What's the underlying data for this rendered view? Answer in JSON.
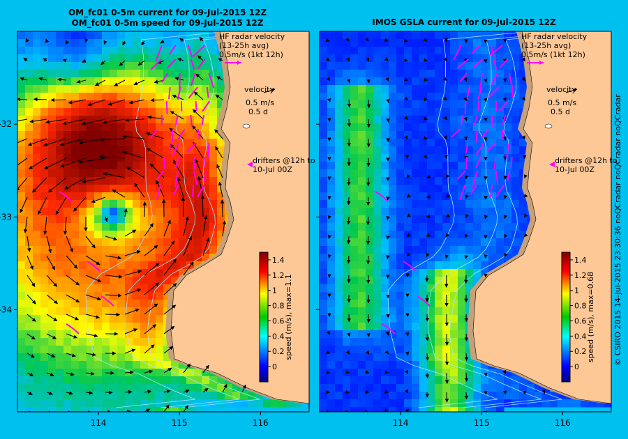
{
  "colors": {
    "background": "#00c0f0",
    "land": "#fdc896",
    "shelf": "#c8a078",
    "radar": "#ff00ff",
    "arrow": "#000000"
  },
  "panels": [
    {
      "title_line1": "OM_fc01 0-5m current for 09-Jul-2015 12Z",
      "title_line2": "OM_fc01 0-5m speed for 09-Jul-2015 12Z",
      "legend_radar": [
        "HF radar velocity",
        "(13-25h avg)",
        "0.5m/s (1kt 12h)"
      ],
      "legend_velocity": [
        "velocity",
        "0.5 m/s",
        "0.5 d"
      ],
      "legend_drifters": [
        "drifters @12h to",
        "10-Jul 00Z"
      ],
      "colorbar_label": "speed (m/s), max=1.1"
    },
    {
      "title_line1": "IMOS GSLA current for 09-Jul-2015 12Z",
      "title_line2": "",
      "legend_radar": [
        "HF radar velocity",
        "(13-25h avg)",
        "0.5m/s (1kt 12h)"
      ],
      "legend_velocity": [
        "velocity",
        "0.5 m/s",
        "0.5 d"
      ],
      "legend_drifters": [
        "drifters @12h to",
        "10-Jul 00Z"
      ],
      "colorbar_label": "speed (m/s), max=0.68"
    }
  ],
  "credit": "© CSIRO 2015  14-Jul-2015 23:30:36 noQCradar noQCradar noQCradar",
  "chart_data": [
    {
      "type": "heatmap",
      "title": "OM_fc01 0-5m current for 09-Jul-2015 12Z",
      "subtitle": "OM_fc01 0-5m speed for 09-Jul-2015 12Z",
      "xlim": [
        113.0,
        116.6
      ],
      "ylim": [
        -35.1,
        -31.0
      ],
      "xticks": [
        114,
        115,
        116
      ],
      "yticks": [
        -32,
        -33,
        -34
      ],
      "colorbar": {
        "label": "speed (m/s), max=1.1",
        "ticks": [
          0,
          0.2,
          0.4,
          0.6,
          0.8,
          1,
          1.2,
          1.4
        ],
        "range": [
          -0.2,
          1.5
        ]
      },
      "max_speed": 1.1,
      "eddies": [
        {
          "lon": 113.85,
          "lat": -31.65,
          "strength": 0.45,
          "sense": "anticlockwise"
        },
        {
          "lon": 114.15,
          "lat": -32.9,
          "strength": 1.1,
          "sense": "clockwise"
        }
      ]
    },
    {
      "type": "heatmap",
      "title": "IMOS GSLA current for 09-Jul-2015 12Z",
      "xlim": [
        113.0,
        116.6
      ],
      "ylim": [
        -35.1,
        -31.0
      ],
      "xticks": [
        114,
        115,
        116
      ],
      "yticks": [
        -32,
        -33,
        -34
      ],
      "colorbar": {
        "label": "speed (m/s), max=0.68",
        "ticks": [
          0,
          0.2,
          0.4,
          0.6,
          0.8,
          1,
          1.2,
          1.4
        ],
        "range": [
          -0.2,
          1.5
        ]
      },
      "max_speed": 0.68,
      "jets": [
        {
          "lon": 113.5,
          "lat_range": [
            -32.0,
            -33.8
          ],
          "speed": 0.5
        },
        {
          "lon": 114.6,
          "lat_range": [
            -34.0,
            -35.0
          ],
          "speed": 0.55
        }
      ]
    }
  ]
}
